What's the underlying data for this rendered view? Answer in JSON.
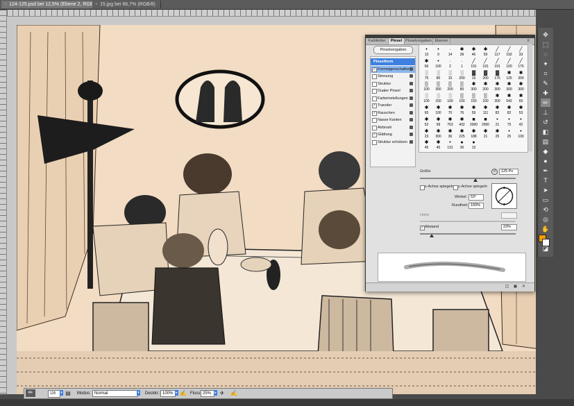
{
  "document_tabs": [
    {
      "title": "124-125.psd bei 12,5% (Ebene 2, RGB/8) *",
      "active": true
    },
    {
      "title": "15.jpg bei 66,7% (RGB/8)",
      "active": false
    }
  ],
  "brush_panel": {
    "tabs": [
      "Farbfelder",
      "Pinsel",
      "Pinselvorgaben",
      "Ebenen"
    ],
    "active_tab": "Pinsel",
    "presets_button": "Pinselvorgaben",
    "options": [
      {
        "label": "Pinselform",
        "header": true
      },
      {
        "label": "Formeigenschaften",
        "checked": true,
        "selected": true
      },
      {
        "label": "Streuung",
        "checked": false
      },
      {
        "label": "Struktur",
        "checked": false
      },
      {
        "label": "Dualer Pinsel",
        "checked": false
      },
      {
        "label": "Farbeinstellungen",
        "checked": false
      },
      {
        "label": "Transfer",
        "checked": true
      },
      {
        "label": "Rauschen",
        "checked": true
      },
      {
        "label": "Nasse Kanten",
        "checked": false
      },
      {
        "label": "Airbrush",
        "checked": false
      },
      {
        "label": "Glättung",
        "checked": true
      },
      {
        "label": "Struktur schützen",
        "checked": false
      }
    ],
    "brush_tips": [
      {
        "glyph": "•",
        "size": "13"
      },
      {
        "glyph": "•",
        "size": "9"
      },
      {
        "glyph": "·",
        "size": "14"
      },
      {
        "glyph": "✱",
        "size": "39"
      },
      {
        "glyph": "✱",
        "size": "46"
      },
      {
        "glyph": "✱",
        "size": "59"
      },
      {
        "glyph": "╱",
        "size": "117"
      },
      {
        "glyph": "╱",
        "size": "192"
      },
      {
        "glyph": "╱",
        "size": "33"
      },
      {
        "glyph": "✱",
        "size": "66"
      },
      {
        "glyph": "•",
        "size": "100"
      },
      {
        "glyph": "·",
        "size": "2"
      },
      {
        "glyph": "·",
        "size": "1"
      },
      {
        "glyph": "╱",
        "size": "191"
      },
      {
        "glyph": "╱",
        "size": "191"
      },
      {
        "glyph": "╱",
        "size": "191"
      },
      {
        "glyph": "╱",
        "size": "100"
      },
      {
        "glyph": "╱",
        "size": "175"
      },
      {
        "glyph": "░",
        "size": "75"
      },
      {
        "glyph": "░",
        "size": "80"
      },
      {
        "glyph": "░",
        "size": "15"
      },
      {
        "glyph": "░",
        "size": "200"
      },
      {
        "glyph": "▓",
        "size": "15"
      },
      {
        "glyph": "▓",
        "size": "200"
      },
      {
        "glyph": "▓",
        "size": "175"
      },
      {
        "glyph": "✱",
        "size": "125"
      },
      {
        "glyph": "✱",
        "size": "300"
      },
      {
        "glyph": "▒",
        "size": "100"
      },
      {
        "glyph": "▒",
        "size": "300"
      },
      {
        "glyph": "▒",
        "size": "200"
      },
      {
        "glyph": "▒",
        "size": "80"
      },
      {
        "glyph": "✱",
        "size": "300"
      },
      {
        "glyph": "✱",
        "size": "200"
      },
      {
        "glyph": "✱",
        "size": "300"
      },
      {
        "glyph": "✱",
        "size": "300"
      },
      {
        "glyph": "✱",
        "size": "300"
      },
      {
        "glyph": "░",
        "size": "100"
      },
      {
        "glyph": "░",
        "size": "150"
      },
      {
        "glyph": "░",
        "size": "100"
      },
      {
        "glyph": "▒",
        "size": "100"
      },
      {
        "glyph": "▒",
        "size": "150"
      },
      {
        "glyph": "▒",
        "size": "100"
      },
      {
        "glyph": "✱",
        "size": "300"
      },
      {
        "glyph": "✱",
        "size": "542"
      },
      {
        "glyph": "✱",
        "size": "65"
      },
      {
        "glyph": "✱",
        "size": "65"
      },
      {
        "glyph": "✱",
        "size": "100"
      },
      {
        "glyph": "✱",
        "size": "70"
      },
      {
        "glyph": "✱",
        "size": "76"
      },
      {
        "glyph": "✱",
        "size": "59"
      },
      {
        "glyph": "✱",
        "size": "111"
      },
      {
        "glyph": "✱",
        "size": "82"
      },
      {
        "glyph": "✱",
        "size": "82"
      },
      {
        "glyph": "✱",
        "size": "53"
      },
      {
        "glyph": "✱",
        "size": "52"
      },
      {
        "glyph": "✱",
        "size": "99"
      },
      {
        "glyph": "✱",
        "size": "763"
      },
      {
        "glyph": "✱",
        "size": "432"
      },
      {
        "glyph": "■",
        "size": "2000"
      },
      {
        "glyph": "■",
        "size": "2000"
      },
      {
        "glyph": "•",
        "size": "21"
      },
      {
        "glyph": "•",
        "size": "75"
      },
      {
        "glyph": "•",
        "size": "42"
      },
      {
        "glyph": "✱",
        "size": "23"
      },
      {
        "glyph": "✱",
        "size": "300"
      },
      {
        "glyph": "✱",
        "size": "36"
      },
      {
        "glyph": "✱",
        "size": "225"
      },
      {
        "glyph": "✱",
        "size": "188"
      },
      {
        "glyph": "✱",
        "size": "21"
      },
      {
        "glyph": "✱",
        "size": "25"
      },
      {
        "glyph": "•",
        "size": "25"
      },
      {
        "glyph": "•",
        "size": "100"
      },
      {
        "glyph": "✱",
        "size": "45"
      },
      {
        "glyph": "✱",
        "size": "45"
      },
      {
        "glyph": "•",
        "size": "131"
      },
      {
        "glyph": "●",
        "size": "30"
      },
      {
        "glyph": "●",
        "size": "13"
      }
    ],
    "size_label": "Größe",
    "size_value": "125 Px",
    "flip_x_label": "x-Achse spiegeln",
    "flip_y_label": "y-Achse spiegeln",
    "angle_label": "Winkel:",
    "angle_value": "53°",
    "roundness_label": "Rundheit:",
    "roundness_value": "100%",
    "hardness_label": "Härte",
    "spacing_label": "Abstand",
    "spacing_value": "23%"
  },
  "options_bar": {
    "brush_size": "125",
    "mode_label": "Modus:",
    "mode_value": "Normal",
    "opacity_label": "Deckkr.:",
    "opacity_value": "100%",
    "flow_label": "Fluss:",
    "flow_value": "25%"
  },
  "colors": {
    "foreground": "#ff9d00",
    "background": "#ffffff",
    "accent": "#3d80df"
  }
}
